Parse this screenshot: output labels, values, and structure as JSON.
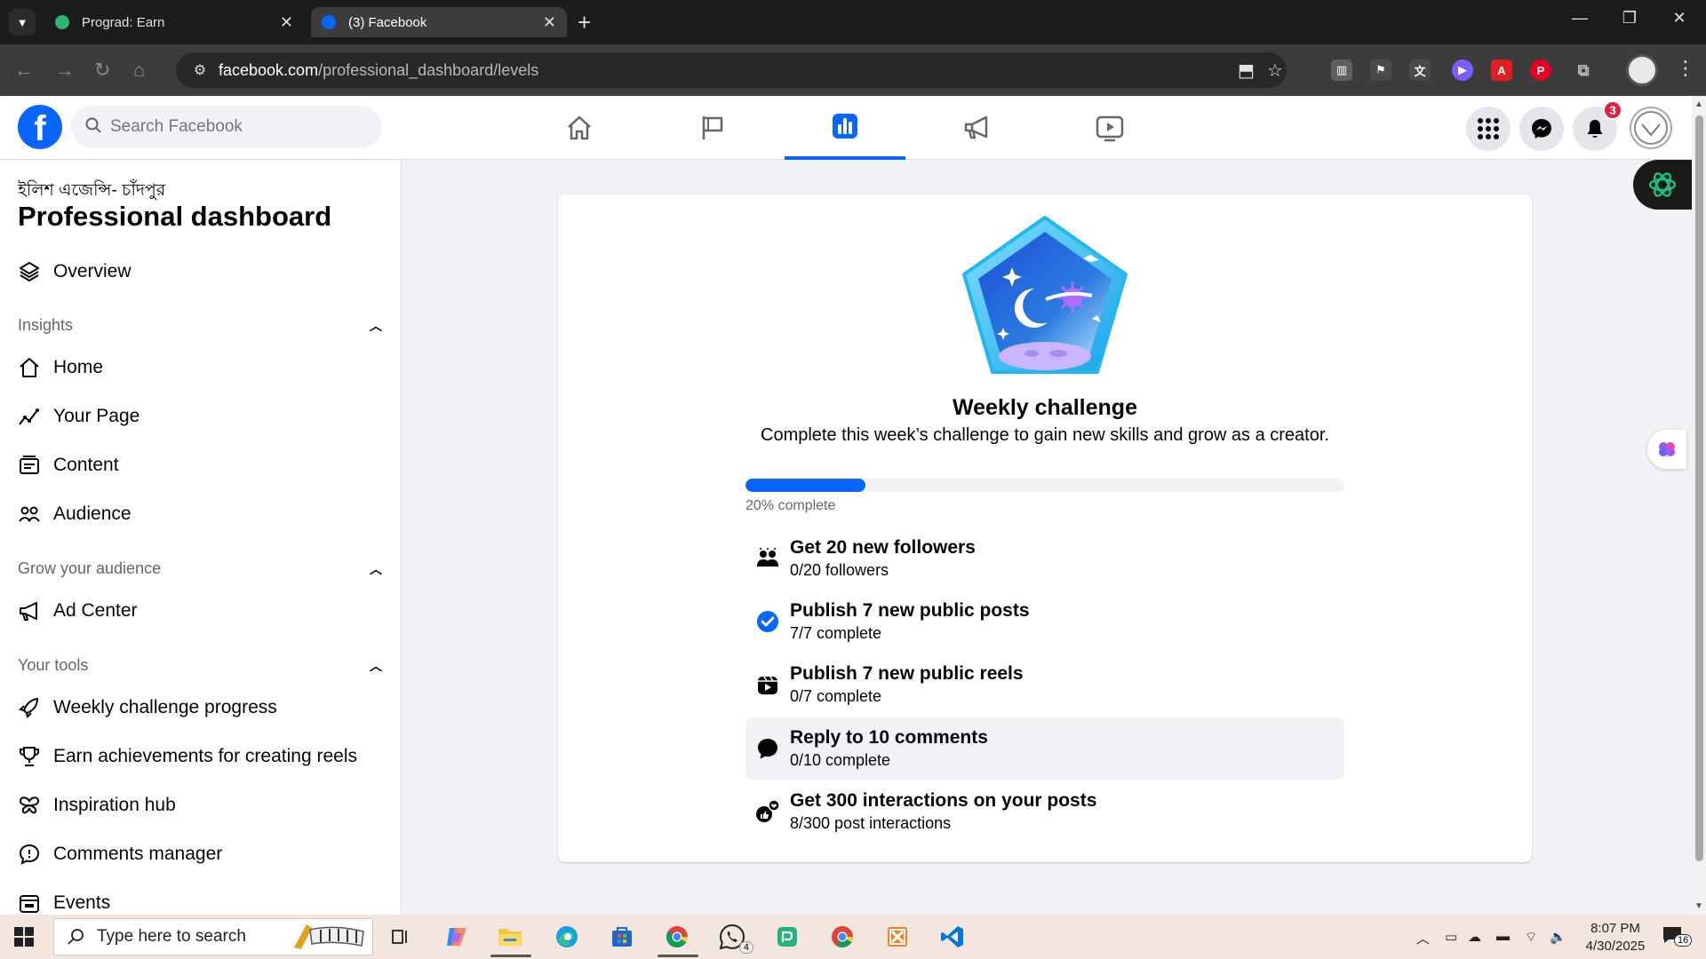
{
  "browser": {
    "tabs": [
      {
        "label": "Prograd: Earn",
        "color": "#2bb673"
      },
      {
        "label": "(3) Facebook",
        "color": "#0866ff"
      }
    ],
    "url_host": "facebook.com",
    "url_path": "/professional_dashboard/levels"
  },
  "fb": {
    "search_placeholder": "Search Facebook",
    "notifications_count": "3"
  },
  "sidebar": {
    "page_name": "ইলিশ এজেন্সি- চাঁদপুর",
    "title": "Professional dashboard",
    "overview": "Overview",
    "insights_header": "Insights",
    "insights": [
      "Home",
      "Your Page",
      "Content",
      "Audience"
    ],
    "grow_header": "Grow your audience",
    "grow": [
      "Ad Center"
    ],
    "tools_header": "Your tools",
    "tools": [
      "Weekly challenge progress",
      "Earn achievements for creating reels",
      "Inspiration hub",
      "Comments manager",
      "Events"
    ]
  },
  "challenge": {
    "title": "Weekly challenge",
    "subtitle": "Complete this week’s challenge to gain new skills and grow as a creator.",
    "progress_fraction": 0.2,
    "progress_label": "20% complete",
    "tasks": [
      {
        "name": "Get 20 new followers",
        "status": "0/20 followers",
        "icon": "people-icon"
      },
      {
        "name": "Publish 7 new public posts",
        "status": "7/7 complete",
        "icon": "check-circle-icon"
      },
      {
        "name": "Publish 7 new public reels",
        "status": "0/7 complete",
        "icon": "reels-icon"
      },
      {
        "name": "Reply to 10 comments",
        "status": "0/10 complete",
        "icon": "comment-icon"
      },
      {
        "name": "Get 300 interactions on your posts",
        "status": "8/300 post interactions",
        "icon": "interactions-icon"
      }
    ]
  },
  "taskbar": {
    "search_placeholder": "Type here to search",
    "time": "8:07 PM",
    "date": "4/30/2025",
    "whatsapp_badge": "4",
    "notification_count": "16"
  }
}
